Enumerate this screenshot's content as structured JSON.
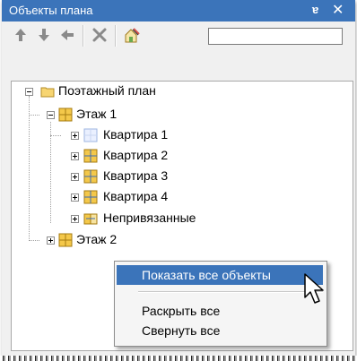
{
  "panel": {
    "title": "Объекты плана",
    "pin_glyph": "ɐ",
    "close_glyph": "✕"
  },
  "toolbar": {
    "search_value": "",
    "buttons": [
      "arrow-up-icon",
      "arrow-down-icon",
      "arrow-left-icon",
      "delete-icon",
      "properties-icon"
    ]
  },
  "tree": {
    "root": {
      "label": "Поэтажный план",
      "expanded": true
    },
    "floor1": {
      "label": "Этаж 1",
      "expanded": true
    },
    "apartments": [
      {
        "label": "Квартира 1"
      },
      {
        "label": "Квартира 2"
      },
      {
        "label": "Квартира 3"
      },
      {
        "label": "Квартира 4"
      }
    ],
    "unbound": {
      "label": "Непривязанные"
    },
    "floor2": {
      "label": "Этаж 2",
      "expanded": false
    }
  },
  "context_menu": {
    "show_all": "Показать все объекты",
    "expand_all": "Раскрыть все",
    "collapse_all": "Свернуть все"
  },
  "colors": {
    "title_bar": "#3b74ba",
    "highlight": "#3b74ba",
    "folder": "#e9c15b"
  }
}
